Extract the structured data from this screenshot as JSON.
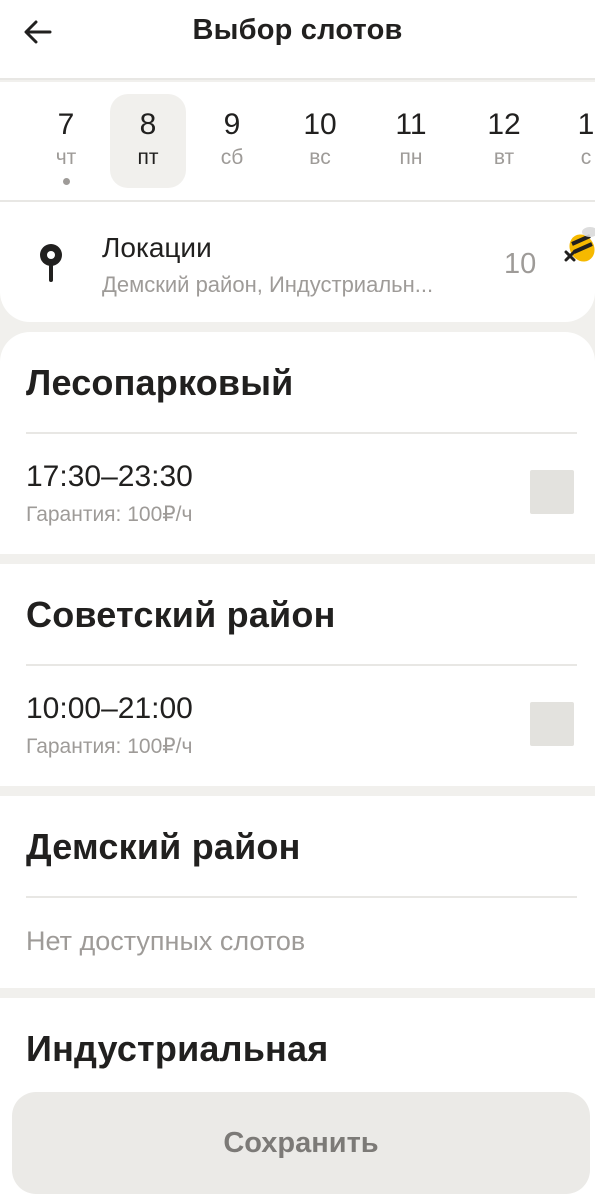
{
  "header": {
    "title": "Выбор слотов",
    "back_icon": "arrow-left-icon"
  },
  "dates": [
    {
      "num": "7",
      "day": "чт",
      "today": true
    },
    {
      "num": "8",
      "day": "пт",
      "selected": true
    },
    {
      "num": "9",
      "day": "сб"
    },
    {
      "num": "10",
      "day": "вс"
    },
    {
      "num": "11",
      "day": "пн"
    },
    {
      "num": "12",
      "day": "вт"
    },
    {
      "num": "1",
      "day": "с"
    }
  ],
  "location": {
    "title": "Локации",
    "subtitle": "Демский район, Индустриальн...",
    "count": "10",
    "icon": "map-pin-icon"
  },
  "sections": [
    {
      "title": "Лесопарковый",
      "slot": {
        "time": "17:30–23:30",
        "guarantee": "Гарантия: 100₽/ч",
        "checked": false
      }
    },
    {
      "title": "Советский район",
      "slot": {
        "time": "10:00–21:00",
        "guarantee": "Гарантия: 100₽/ч",
        "checked": false
      }
    },
    {
      "title": "Демский район",
      "empty": "Нет доступных слотов"
    },
    {
      "title": "Индустриальная"
    }
  ],
  "footer": {
    "save_label": "Сохранить"
  },
  "colors": {
    "background": "#f1f0ed",
    "card": "#ffffff",
    "muted_text": "#9e9b98",
    "checkbox": "#e3e2de",
    "button": "#ebeae7"
  }
}
